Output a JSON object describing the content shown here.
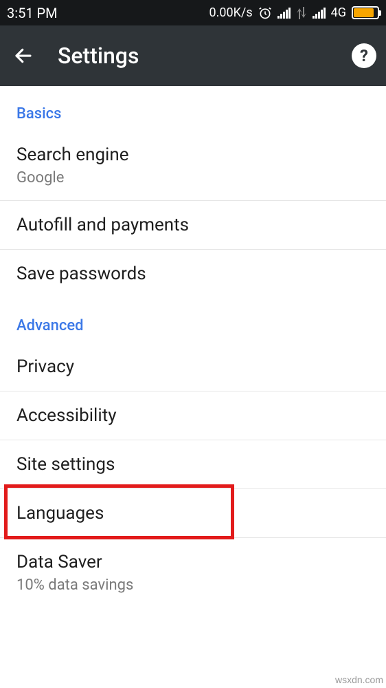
{
  "status": {
    "time": "3:51 PM",
    "speed": "0.00K/s",
    "network_label": "4G"
  },
  "appbar": {
    "title": "Settings"
  },
  "sections": {
    "basics": {
      "header": "Basics",
      "search_engine": {
        "title": "Search engine",
        "value": "Google"
      },
      "autofill": {
        "title": "Autofill and payments"
      },
      "passwords": {
        "title": "Save passwords"
      }
    },
    "advanced": {
      "header": "Advanced",
      "privacy": {
        "title": "Privacy"
      },
      "accessibility": {
        "title": "Accessibility"
      },
      "site_settings": {
        "title": "Site settings"
      },
      "languages": {
        "title": "Languages"
      },
      "data_saver": {
        "title": "Data Saver",
        "value": "10% data savings"
      }
    }
  },
  "watermark": "wsxdn.com"
}
